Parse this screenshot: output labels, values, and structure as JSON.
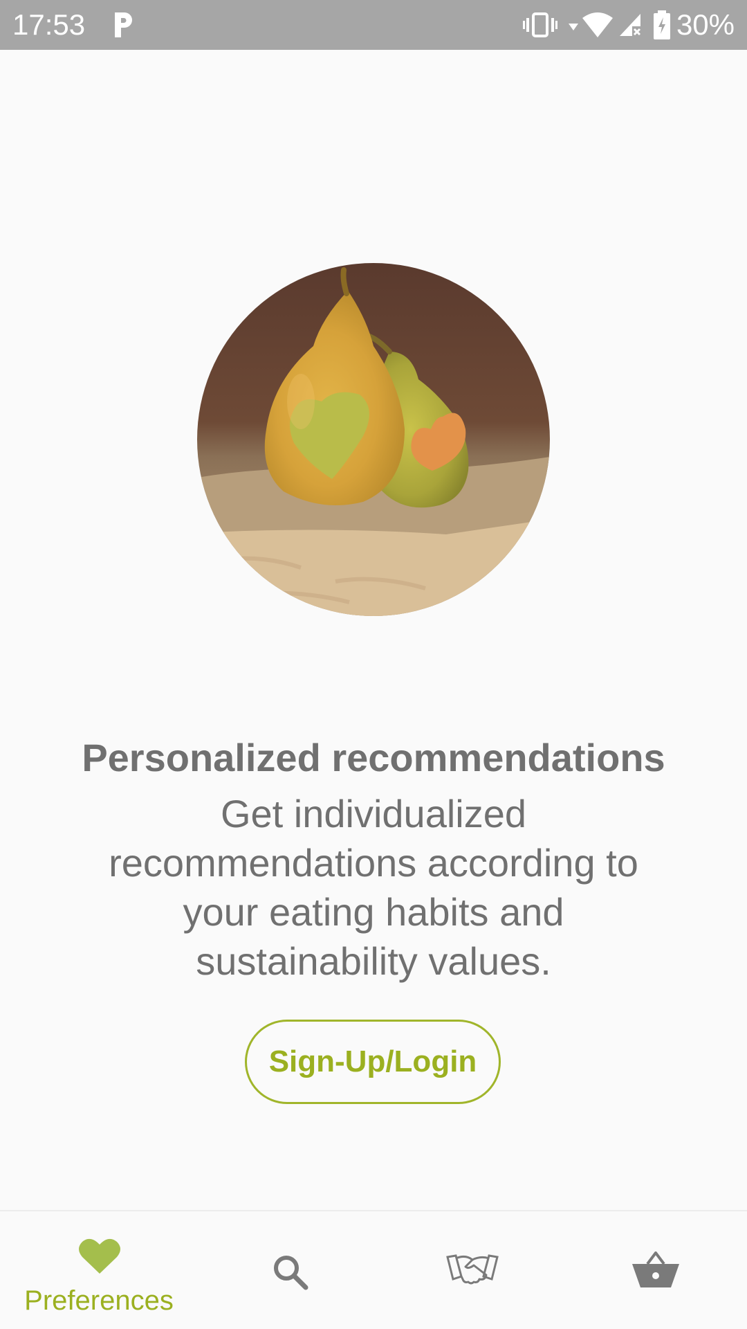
{
  "status_bar": {
    "time": "17:53",
    "battery": "30%",
    "icons": [
      "parking-icon",
      "vibrate-icon",
      "wifi-icon",
      "signal-icon",
      "battery-charging-icon"
    ]
  },
  "hero": {
    "icon": "pears-hearts-image"
  },
  "content": {
    "title": "Personalized recommendations",
    "description": "Get individualized recommendations according to your eating habits and sustainability values."
  },
  "button": {
    "label": "Sign-Up/Login"
  },
  "bottom_nav": {
    "items": [
      {
        "label": "Preferences",
        "icon": "heart-icon",
        "active": true
      },
      {
        "label": "",
        "icon": "search-icon",
        "active": false
      },
      {
        "label": "",
        "icon": "handshake-icon",
        "active": false
      },
      {
        "label": "",
        "icon": "basket-icon",
        "active": false
      }
    ]
  },
  "colors": {
    "accent": "#9bb020",
    "status_bar": "#a6a6a6",
    "text": "#707070",
    "background": "#fafafa"
  }
}
